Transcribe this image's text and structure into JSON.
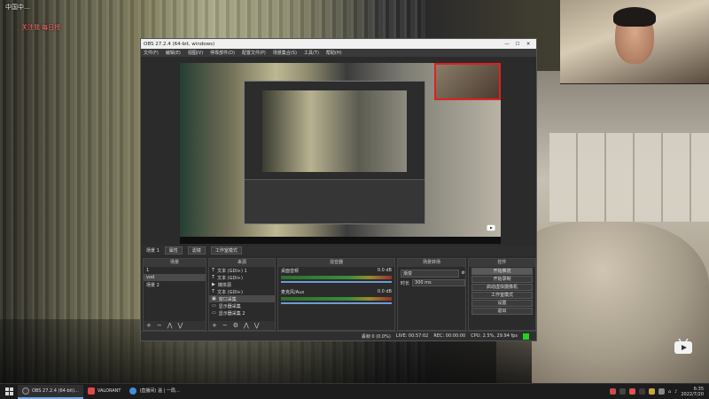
{
  "overlay": {
    "top_left_line1": "中国中…",
    "top_left_line2": "关注我 每日榜"
  },
  "obs": {
    "title": "OBS 27.2.4 (64-bit, windows)",
    "window_buttons": [
      "—",
      "☐",
      "✕"
    ],
    "menu": [
      "文件(F)",
      "编辑(E)",
      "视图(V)",
      "停靠部件(D)",
      "配置文件(P)",
      "场景集合(S)",
      "工具(T)",
      "帮助(H)"
    ],
    "scene_bar": {
      "label": "场景 1",
      "btn_props": "属性",
      "btn_filters": "滤镜",
      "btn_studio": "工作室模式"
    },
    "docks": {
      "scenes": {
        "title": "场景",
        "items": [
          "1",
          "vod",
          "场景 2"
        ]
      },
      "sources": {
        "title": "来源",
        "items": [
          "文本 (GDI+) 1",
          "文本 (GDI+)",
          "媒体源",
          "文本 (GDI+)",
          "窗口采集",
          "显示器采集",
          "显示器采集 2"
        ]
      },
      "mixer": {
        "title": "混音器",
        "channels": [
          {
            "name": "桌面音频",
            "db": "0.0 dB"
          },
          {
            "name": "麦克风/Aux",
            "db": "0.0 dB"
          }
        ]
      },
      "transitions": {
        "title": "场景转场",
        "type": "渐变",
        "duration_label": "时长",
        "duration": "300 ms"
      },
      "controls": {
        "title": "控件",
        "buttons": [
          "开始推流",
          "开始录制",
          "启动虚拟摄像机",
          "工作室模式",
          "设置",
          "退出"
        ]
      }
    },
    "status": {
      "dropped": "丢帧 0 (0.0%)",
      "live": "LIVE: 00:57:02",
      "rec": "REC: 00:00:00",
      "cpu": "CPU: 2.5%, 29.94 fps"
    }
  },
  "taskbar": {
    "tasks": [
      {
        "label": "OBS 27.2.4 (64-bit)...",
        "color": "#3a3a3a"
      },
      {
        "label": "VALORANT",
        "color": "#e04848"
      },
      {
        "label": "(直播间) 温 | 一局…",
        "color": "#3e8ee0"
      }
    ],
    "time": "6:35",
    "date": "2022/7/20"
  },
  "colors": {
    "accent": "#7aa8e6",
    "selection": "#e02020",
    "status_ok": "#21d321"
  }
}
